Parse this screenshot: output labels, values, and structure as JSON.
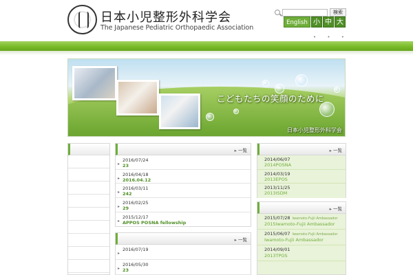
{
  "header": {
    "org_name_jp": "日本小児整形外科学会",
    "org_name_en": "The Japanese Pediatric Orthopaedic Association",
    "search_button": "検索",
    "search_placeholder": "",
    "english_button": "English",
    "font_size": {
      "small": "小",
      "medium": "中",
      "large": "大"
    },
    "dots": "• • •"
  },
  "hero": {
    "tagline": "こどもたちの笑顔のために",
    "org_name": "日本小児整形外科学会"
  },
  "panels": {
    "more_label": "一覧",
    "mid_top": [
      {
        "date": "2016/07/24",
        "title": "23"
      },
      {
        "date": "2016/04/18",
        "title": "2016.04.12"
      },
      {
        "date": "2016/03/11",
        "title": "242"
      },
      {
        "date": "2016/02/25",
        "title": "29"
      },
      {
        "date": "2015/12/17",
        "title": "APPOS POSNA fellowship"
      }
    ],
    "mid_bottom": [
      {
        "date": "2016/07/19",
        "title": ""
      },
      {
        "date": "2016/05/30",
        "title": "23"
      }
    ],
    "right_top": [
      {
        "date": "2014/06/07",
        "title": "2014POSNA"
      },
      {
        "date": "2014/03/19",
        "title": "2013EPOS"
      },
      {
        "date": "2013/11/25",
        "title": "2013ISDM"
      }
    ],
    "right_bottom": [
      {
        "date": "2015/07/28",
        "tag": "Iwamoto-Fujii Ambassador",
        "title": "2015Iwamoto-Fujii Ambassador"
      },
      {
        "date": "2015/06/07",
        "tag": "Iwamoto-Fujii Ambassador",
        "title": "Iwamoto-Fujii Ambassador"
      },
      {
        "date": "2014/09/01",
        "tag": "",
        "title": "2013TPOS"
      }
    ]
  },
  "colors": {
    "brand_green": "#6fae3a",
    "dark_green": "#4f8f26",
    "panel_tint": "#e9f3d9"
  }
}
